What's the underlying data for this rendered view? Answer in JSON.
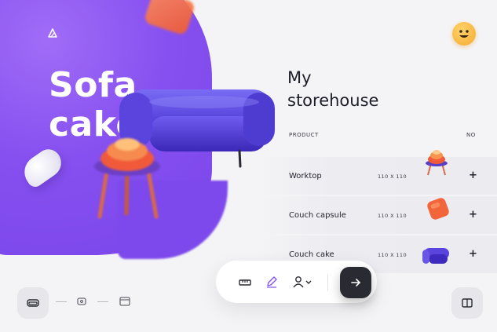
{
  "hero": {
    "title_line1": "Sofa",
    "title_line2": "cake"
  },
  "storehouse": {
    "title_line1": "My",
    "title_line2": "storehouse",
    "column_product": "PRODUCT",
    "column_no": "NO"
  },
  "products": [
    {
      "name": "Worktop",
      "size": "110 X 110",
      "thumb": "stool-icon",
      "action": "+"
    },
    {
      "name": "Couch capsule",
      "size": "110 X 110",
      "thumb": "pillow-icon",
      "action": "+"
    },
    {
      "name": "Couch cake",
      "size": "110 X 110",
      "thumb": "sofa-icon",
      "action": "+"
    }
  ],
  "toolbar": {
    "icons": [
      "ruler-icon",
      "pen-icon",
      "user-icon",
      "chevron-down-icon"
    ],
    "go_icon": "arrow-right-icon"
  },
  "steps": [
    "sofa-icon",
    "chair-icon",
    "window-icon"
  ],
  "corner_right_icon": "panel-icon",
  "colors": {
    "brand_purple": "#8650f0",
    "dark_button": "#2a2a33",
    "accent_orange": "#f25c2e",
    "emoji_yellow": "#f7b23a"
  }
}
